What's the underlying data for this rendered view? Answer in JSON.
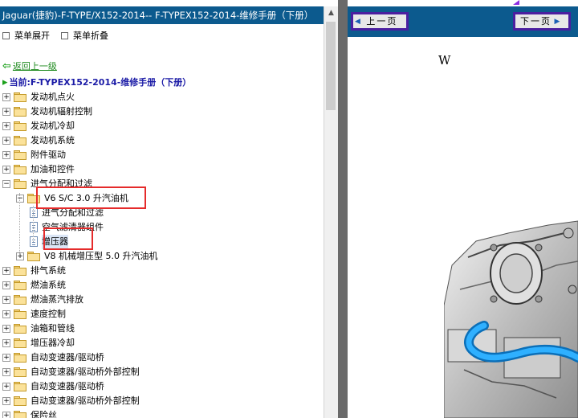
{
  "left_panel": {
    "title": "Jaguar(捷豹)-F-TYPE/X152-2014-- F-TYPEX152-2014-维修手册（下册）",
    "menu": {
      "expand": "菜单展开",
      "collapse": "菜单折叠"
    },
    "back_link": "返回上一级",
    "current": "当前:F-TYPEX152-2014-维修手册（下册）",
    "tree": [
      {
        "label": "发动机点火",
        "type": "folder",
        "state": "collapsed"
      },
      {
        "label": "发动机辐射控制",
        "type": "folder",
        "state": "collapsed"
      },
      {
        "label": "发动机冷却",
        "type": "folder",
        "state": "collapsed"
      },
      {
        "label": "发动机系统",
        "type": "folder",
        "state": "collapsed"
      },
      {
        "label": "附件驱动",
        "type": "folder",
        "state": "collapsed"
      },
      {
        "label": "加油和控件",
        "type": "folder",
        "state": "collapsed"
      },
      {
        "label": "进气分配和过滤",
        "type": "folder",
        "state": "expanded"
      },
      {
        "label": "V6 S/C 3.0 升汽油机",
        "type": "folder",
        "state": "expanded"
      },
      {
        "label": "进气分配和过滤",
        "type": "document"
      },
      {
        "label": "空气滤清器组件",
        "type": "document"
      },
      {
        "label": "增压器",
        "type": "document",
        "selected": true
      },
      {
        "label": "V8 机械增压型 5.0 升汽油机",
        "type": "folder",
        "state": "collapsed"
      },
      {
        "label": "排气系统",
        "type": "folder",
        "state": "collapsed"
      },
      {
        "label": "燃油系统",
        "type": "folder",
        "state": "collapsed"
      },
      {
        "label": "燃油蒸汽排放",
        "type": "folder",
        "state": "collapsed"
      },
      {
        "label": "速度控制",
        "type": "folder",
        "state": "collapsed"
      },
      {
        "label": "油箱和管线",
        "type": "folder",
        "state": "collapsed"
      },
      {
        "label": "增压器冷却",
        "type": "folder",
        "state": "collapsed"
      },
      {
        "label": "自动变速器/驱动桥",
        "type": "folder",
        "state": "collapsed"
      },
      {
        "label": "自动变速器/驱动桥外部控制",
        "type": "folder",
        "state": "collapsed"
      },
      {
        "label": "自动变速器/驱动桥",
        "type": "folder",
        "state": "collapsed"
      },
      {
        "label": "自动变速器/驱动桥外部控制",
        "type": "folder",
        "state": "collapsed"
      },
      {
        "label": "保险丝",
        "type": "folder",
        "state": "collapsed"
      }
    ]
  },
  "right_panel": {
    "prev_label": "上一页",
    "next_label": "下一页",
    "page_letter": "W"
  },
  "colors": {
    "header_blue": "#0c5a8e",
    "highlight_red": "#e52b2b",
    "button_border_purple": "#4b1fa0",
    "hose_blue": "#1e9be8",
    "divider_gray": "#6a6a6a"
  }
}
